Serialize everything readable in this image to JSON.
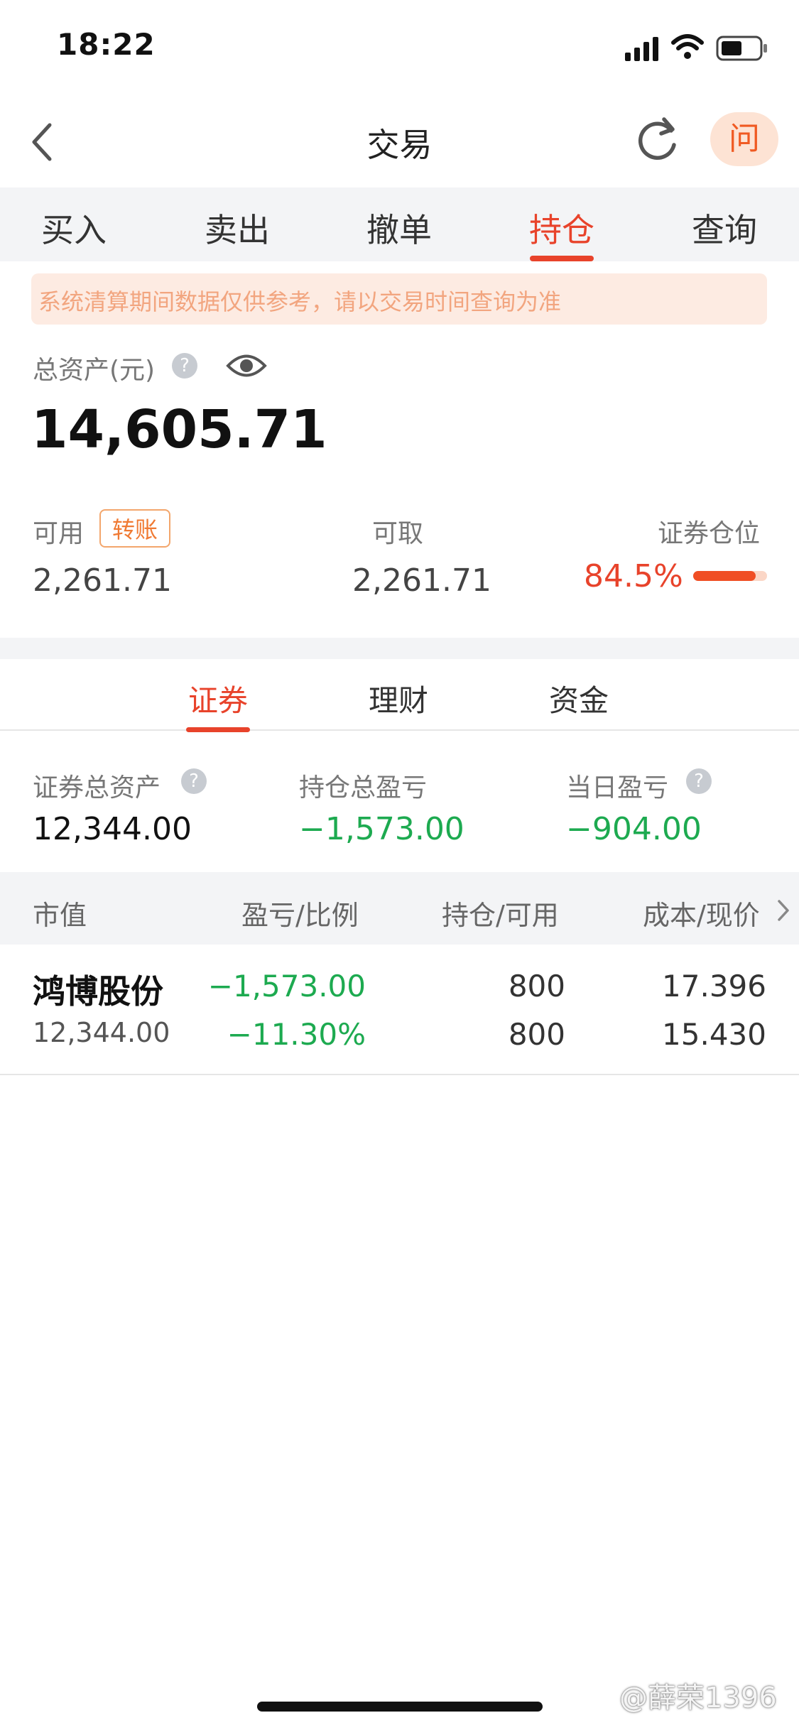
{
  "status_bar": {
    "time": "18:22"
  },
  "nav": {
    "title": "交易",
    "ask_label": "问"
  },
  "main_tabs": [
    {
      "label": "买入"
    },
    {
      "label": "卖出"
    },
    {
      "label": "撤单"
    },
    {
      "label": "持仓"
    },
    {
      "label": "查询"
    }
  ],
  "active_main_tab": "持仓",
  "notice": "系统清算期间数据仅供参考，请以交易时间查询为准",
  "account": {
    "total_label": "总资产(元)",
    "total_value": "14,605.71",
    "available_label": "可用",
    "transfer_label": "转账",
    "available_value": "2,261.71",
    "withdrawable_label": "可取",
    "withdrawable_value": "2,261.71",
    "position_label": "证券仓位",
    "position_value": "84.5%",
    "position_fraction": 0.845
  },
  "sub_tabs": [
    {
      "label": "证券"
    },
    {
      "label": "理财"
    },
    {
      "label": "资金"
    }
  ],
  "active_sub_tab": "证券",
  "securities": {
    "total_assets_label": "证券总资产",
    "total_assets_value": "12,344.00",
    "holding_pl_label": "持仓总盈亏",
    "holding_pl_value": "−1,573.00",
    "daily_pl_label": "当日盈亏",
    "daily_pl_value": "−904.00"
  },
  "table": {
    "headers": [
      "市值",
      "盈亏/比例",
      "持仓/可用",
      "成本/现价"
    ],
    "rows": [
      {
        "name": "鸿博股份",
        "market_value": "12,344.00",
        "pl": "−1,573.00",
        "pl_ratio": "−11.30%",
        "holding": "800",
        "available": "800",
        "cost": "17.396",
        "price": "15.430"
      }
    ]
  },
  "watermark": "@薛荣1396",
  "colors": {
    "accent": "#e8432b",
    "loss_green": "#1daa50",
    "notice_bg": "#fdebe2",
    "notice_text": "#f2a57f"
  }
}
